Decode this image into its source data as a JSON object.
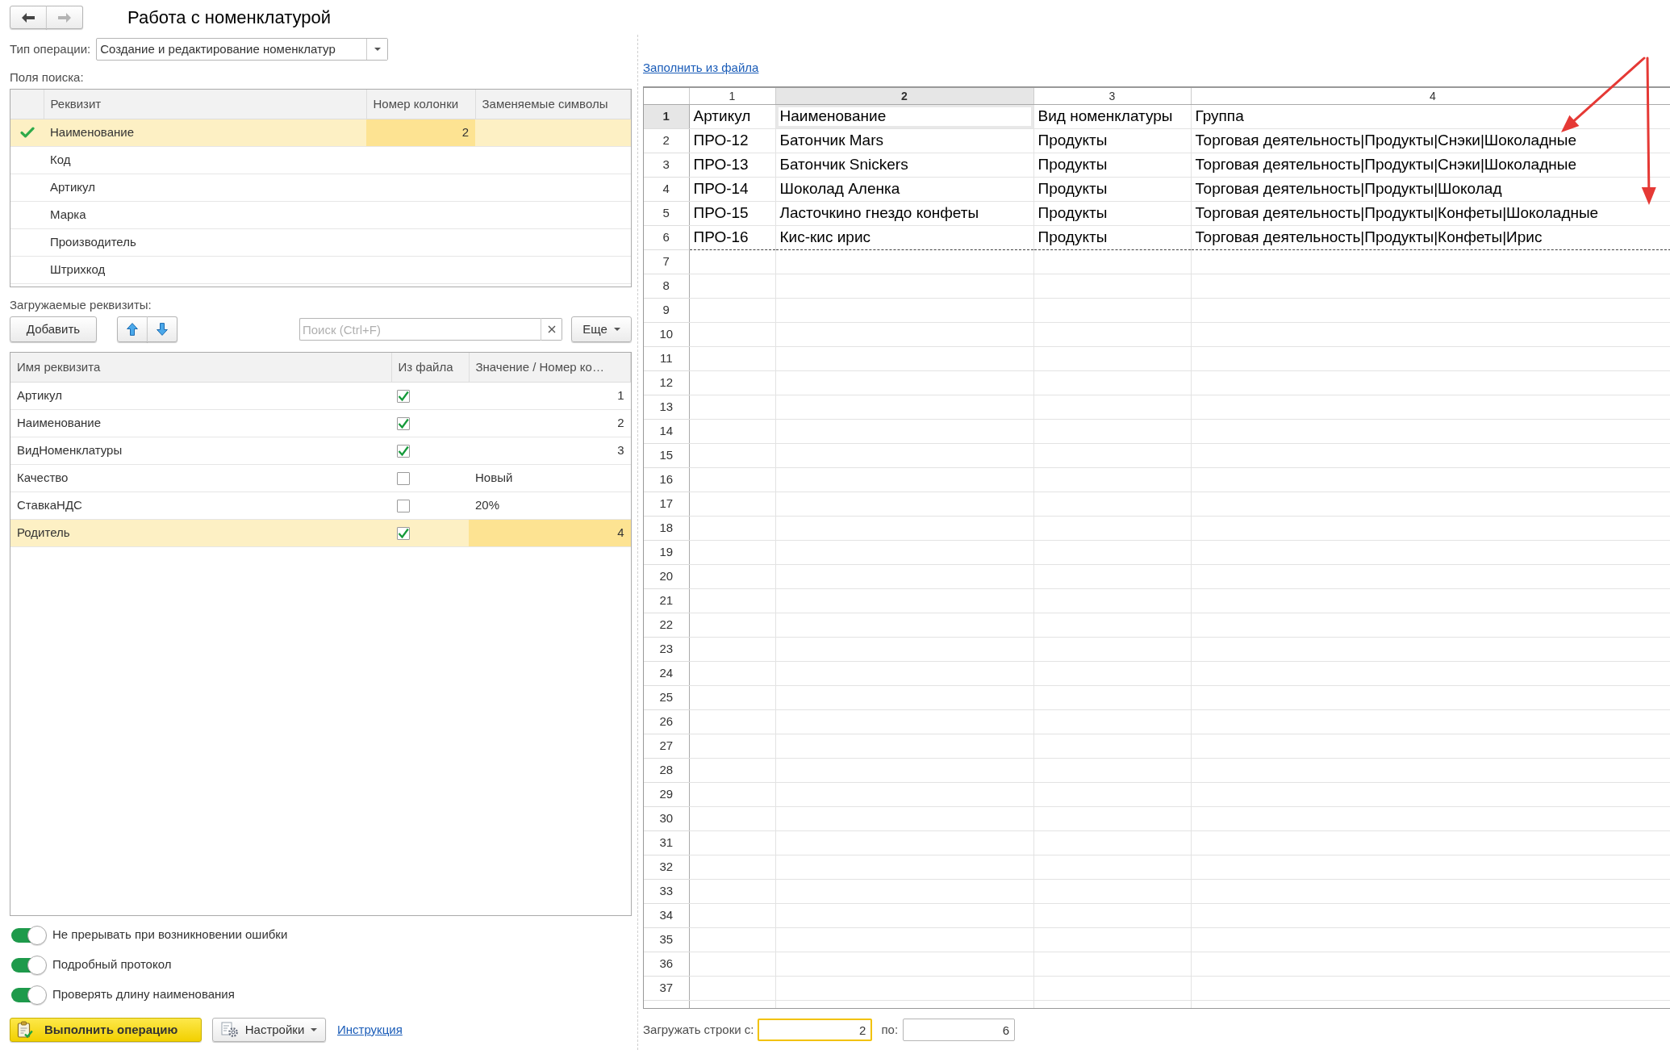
{
  "window": {
    "title": "Работа с номенклатурой"
  },
  "nav_buttons": [
    {
      "kind": "back",
      "disabled": false
    },
    {
      "kind": "forward",
      "disabled": true
    }
  ],
  "operation_type": {
    "label": "Тип операции:",
    "value": "Создание и редактирование номенклатур"
  },
  "search_fields": {
    "label": "Поля поиска:",
    "columns": [
      "Реквизит",
      "Номер колонки",
      "Заменяемые символы"
    ],
    "rows": [
      {
        "name": "Наименование",
        "column_number": "2",
        "checked": true,
        "selected": true
      },
      {
        "name": "Код",
        "checked": false,
        "selected": false
      },
      {
        "name": "Артикул",
        "checked": false,
        "selected": false
      },
      {
        "name": "Марка",
        "checked": false,
        "selected": false
      },
      {
        "name": "Производитель",
        "checked": false,
        "selected": false
      },
      {
        "name": "Штрихкод",
        "checked": false,
        "selected": false
      }
    ]
  },
  "loaded_attributes": {
    "label": "Загружаемые реквизиты:",
    "add_button": "Добавить",
    "search": {
      "placeholder": "Поиск (Ctrl+F)"
    },
    "more_button": "Еще",
    "columns": [
      "Имя реквизита",
      "Из файла",
      "Значение / Номер ко…"
    ],
    "rows": [
      {
        "name": "Артикул",
        "from_file": true,
        "value": "1",
        "selected": false
      },
      {
        "name": "Наименование",
        "from_file": true,
        "value": "2",
        "selected": false
      },
      {
        "name": "ВидНоменклатуры",
        "from_file": true,
        "value": "3",
        "selected": false
      },
      {
        "name": "Качество",
        "from_file": false,
        "value": "Новый",
        "selected": false
      },
      {
        "name": "СтавкаНДС",
        "from_file": false,
        "value": "20%",
        "selected": false
      },
      {
        "name": "Родитель",
        "from_file": true,
        "value": "4",
        "selected": true
      }
    ]
  },
  "options": [
    {
      "label": "Не прерывать при возникновении ошибки",
      "on": true
    },
    {
      "label": "Подробный протокол",
      "on": true
    },
    {
      "label": "Проверять длину наименования",
      "on": true
    }
  ],
  "actions": {
    "execute_button": "Выполнить операцию",
    "settings_button": "Настройки",
    "instruction_link": "Инструкция"
  },
  "fill_link": "Заполнить из файла",
  "spreadsheet": {
    "columns": [
      {
        "label": "1",
        "selected": false
      },
      {
        "label": "2",
        "selected": true
      },
      {
        "label": "3",
        "selected": false
      },
      {
        "label": "4",
        "selected": false
      }
    ],
    "rows": [
      {
        "label": "1",
        "selected": true,
        "cells": [
          "Артикул",
          "Наименование",
          "Вид номенклатуры",
          "Группа"
        ]
      },
      {
        "label": "2",
        "selected": false,
        "cells": [
          "ПРО-12",
          "Батончик Mars",
          "Продукты",
          "Торговая деятельность|Продукты|Снэки|Шоколадные"
        ]
      },
      {
        "label": "3",
        "selected": false,
        "cells": [
          "ПРО-13",
          "Батончик Snickers",
          "Продукты",
          "Торговая деятельность|Продукты|Снэки|Шоколадные"
        ]
      },
      {
        "label": "4",
        "selected": false,
        "cells": [
          "ПРО-14",
          "Шоколад Аленка",
          "Продукты",
          "Торговая деятельность|Продукты|Шоколад"
        ]
      },
      {
        "label": "5",
        "selected": false,
        "cells": [
          "ПРО-15",
          "Ласточкино гнездо конфеты",
          "Продукты",
          "Торговая деятельность|Продукты|Конфеты|Шоколадные"
        ]
      },
      {
        "label": "6",
        "selected": false,
        "cells": [
          "ПРО-16",
          "Кис-кис ирис",
          "Продукты",
          "Торговая деятельность|Продукты|Конфеты|Ирис"
        ]
      },
      {
        "label": "7",
        "selected": false
      },
      {
        "label": "8",
        "selected": false
      },
      {
        "label": "9",
        "selected": false
      },
      {
        "label": "10",
        "selected": false
      },
      {
        "label": "11",
        "selected": false
      },
      {
        "label": "12",
        "selected": false
      },
      {
        "label": "13",
        "selected": false
      },
      {
        "label": "14",
        "selected": false
      },
      {
        "label": "15",
        "selected": false
      },
      {
        "label": "16",
        "selected": false
      },
      {
        "label": "17",
        "selected": false
      },
      {
        "label": "18",
        "selected": false
      },
      {
        "label": "19",
        "selected": false
      },
      {
        "label": "20",
        "selected": false
      },
      {
        "label": "21",
        "selected": false
      },
      {
        "label": "22",
        "selected": false
      },
      {
        "label": "23",
        "selected": false
      },
      {
        "label": "24",
        "selected": false
      },
      {
        "label": "25",
        "selected": false
      },
      {
        "label": "26",
        "selected": false
      },
      {
        "label": "27",
        "selected": false
      },
      {
        "label": "28",
        "selected": false
      },
      {
        "label": "29",
        "selected": false
      },
      {
        "label": "30",
        "selected": false
      },
      {
        "label": "31",
        "selected": false
      },
      {
        "label": "32",
        "selected": false
      },
      {
        "label": "33",
        "selected": false
      },
      {
        "label": "34",
        "selected": false
      },
      {
        "label": "35",
        "selected": false
      },
      {
        "label": "36",
        "selected": false
      },
      {
        "label": "37",
        "selected": false
      }
    ]
  },
  "row_range": {
    "from_label": "Загружать строки с:",
    "from": {
      "value": "2",
      "focused": true
    },
    "to_label": "по:",
    "to": {
      "value": "6",
      "focused": false
    }
  }
}
